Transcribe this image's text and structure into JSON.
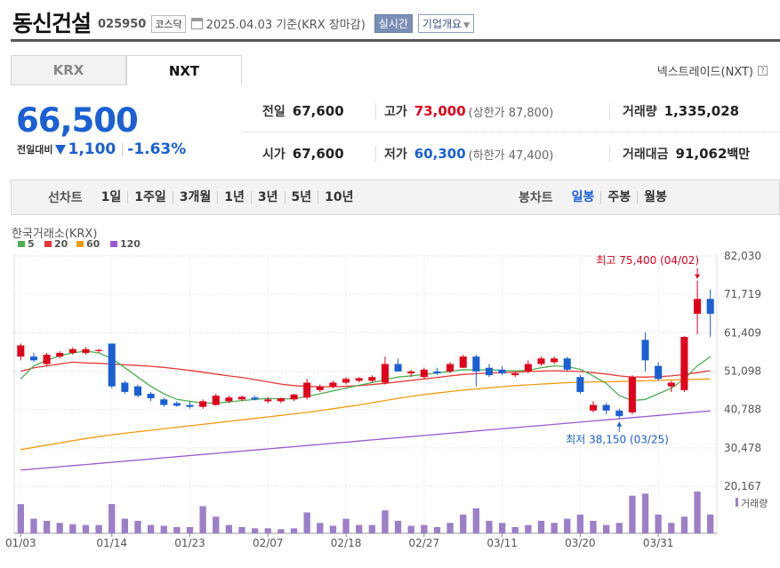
{
  "header": {
    "company_name": "동신건설",
    "code": "025950",
    "market": "코스닥",
    "date_text": "2025.04.03  기준(KRX 장마감)",
    "realtime_button": "실시간",
    "company_info_button": "기업개요",
    "calendar_icon": "calendar-icon"
  },
  "tabs": {
    "krx": "KRX",
    "nxt": "NXT",
    "selected": "NXT"
  },
  "nextrade_label": "넥스트레이드(NXT)",
  "price": {
    "current": "66,500",
    "change_label": "전일대비",
    "change": "1,100",
    "change_pct": "-1.63%",
    "direction": "down"
  },
  "summary": {
    "prev_close_label": "전일",
    "prev_close": "67,600",
    "high_label": "고가",
    "high": "73,000",
    "upper_limit": "(상한가 87,800)",
    "volume_label": "거래량",
    "volume": "1,335,028",
    "open_label": "시가",
    "open": "67,600",
    "low_label": "저가",
    "low": "60,300",
    "lower_limit": "(하한가 47,400)",
    "amount_label": "거래대금",
    "amount": "91,062",
    "amount_unit": "백만"
  },
  "period_bar": {
    "line_title": "선차트",
    "line_items": [
      "1일",
      "1주일",
      "3개월",
      "1년",
      "3년",
      "5년",
      "10년"
    ],
    "candle_title": "봉차트",
    "candle_items": [
      "일봉",
      "주봉",
      "월봉"
    ],
    "candle_selected": "일봉"
  },
  "colors": {
    "up": "#e0001b",
    "down": "#1a5fd4",
    "ma5": "#4caf50",
    "ma20": "#e53935",
    "ma60": "#f39c12",
    "ma120": "#9b59d0",
    "volume": "#9b80c8"
  },
  "chart_data": {
    "type": "candlestick",
    "source_label": "한국거래소(KRX)",
    "legend": [
      {
        "name": "5",
        "color": "#4caf50"
      },
      {
        "name": "20",
        "color": "#e53935"
      },
      {
        "name": "60",
        "color": "#f39c12"
      },
      {
        "name": "120",
        "color": "#9b59d0"
      }
    ],
    "y_ticks": [
      "82,030",
      "71,719",
      "61,409",
      "51,098",
      "40,788",
      "30,478",
      "20,167"
    ],
    "ylim": [
      20167,
      82030
    ],
    "x_ticks": [
      {
        "label": "01/03",
        "index": 0
      },
      {
        "label": "01/14",
        "index": 7
      },
      {
        "label": "01/23",
        "index": 13
      },
      {
        "label": "02/07",
        "index": 19
      },
      {
        "label": "02/18",
        "index": 25
      },
      {
        "label": "02/27",
        "index": 31
      },
      {
        "label": "03/11",
        "index": 37
      },
      {
        "label": "03/20",
        "index": 43
      },
      {
        "label": "03/31",
        "index": 49
      }
    ],
    "n_days": 52,
    "candles": [
      [
        55000,
        58500,
        54000,
        58000
      ],
      [
        55000,
        56000,
        53500,
        54000
      ],
      [
        53000,
        56000,
        52500,
        55500
      ],
      [
        55000,
        56500,
        54500,
        56000
      ],
      [
        56000,
        57500,
        55500,
        57000
      ],
      [
        56000,
        57500,
        55500,
        57000
      ],
      [
        56500,
        57000,
        56000,
        56800
      ],
      [
        58500,
        58500,
        46500,
        47000
      ],
      [
        48000,
        48500,
        45000,
        45500
      ],
      [
        47000,
        47500,
        44000,
        44500
      ],
      [
        45000,
        45500,
        43000,
        43800
      ],
      [
        43500,
        44000,
        41500,
        42000
      ],
      [
        42500,
        43000,
        41500,
        41800
      ],
      [
        42000,
        43000,
        41000,
        41500
      ],
      [
        41500,
        43500,
        41000,
        43000
      ],
      [
        42000,
        45000,
        41800,
        44500
      ],
      [
        43000,
        44500,
        42500,
        44000
      ],
      [
        43500,
        44500,
        43000,
        44200
      ],
      [
        44000,
        44500,
        43200,
        43500
      ],
      [
        43000,
        44000,
        42500,
        43500
      ],
      [
        43000,
        44000,
        42500,
        43800
      ],
      [
        43500,
        45000,
        43000,
        44800
      ],
      [
        44000,
        49000,
        43500,
        48000
      ],
      [
        46000,
        47500,
        45500,
        47000
      ],
      [
        47000,
        48500,
        46500,
        48000
      ],
      [
        48000,
        49500,
        47500,
        49000
      ],
      [
        48500,
        49500,
        48000,
        49200
      ],
      [
        48500,
        50000,
        48000,
        49500
      ],
      [
        48000,
        55000,
        47500,
        53000
      ],
      [
        53000,
        54500,
        51000,
        51000
      ],
      [
        50500,
        51500,
        49500,
        51000
      ],
      [
        49500,
        52000,
        49000,
        51500
      ],
      [
        51000,
        52000,
        50000,
        50500
      ],
      [
        51000,
        53500,
        50500,
        53000
      ],
      [
        52000,
        55500,
        52000,
        55000
      ],
      [
        55000,
        55500,
        47000,
        51000
      ],
      [
        52000,
        53000,
        49500,
        50000
      ],
      [
        51500,
        52500,
        50000,
        50500
      ],
      [
        50000,
        51000,
        49500,
        50500
      ],
      [
        51000,
        54000,
        50500,
        53000
      ],
      [
        53000,
        55000,
        52500,
        54500
      ],
      [
        53500,
        55000,
        53000,
        54500
      ],
      [
        54500,
        55000,
        51000,
        51500
      ],
      [
        49500,
        50000,
        45000,
        45500
      ],
      [
        40500,
        43000,
        40000,
        42000
      ],
      [
        42000,
        42500,
        39500,
        40500
      ],
      [
        40500,
        41000,
        38150,
        39000
      ],
      [
        40000,
        50000,
        39500,
        49500
      ],
      [
        59500,
        61500,
        51000,
        54000
      ],
      [
        52500,
        53500,
        48500,
        49000
      ],
      [
        47000,
        48500,
        45500,
        48000
      ],
      [
        46000,
        60500,
        45500,
        60300
      ]
    ],
    "candles_extra": [
      [
        66500,
        75400,
        61000,
        70500
      ],
      [
        70500,
        73000,
        60300,
        66500
      ]
    ],
    "ma5": [
      49000,
      52500,
      54000,
      55200,
      56000,
      56500,
      56000,
      54500,
      52000,
      49500,
      47000,
      45000,
      43500,
      43000,
      42500,
      42500,
      42800,
      43200,
      43500,
      43800,
      43600,
      43700,
      44300,
      45000,
      45800,
      46500,
      47300,
      48000,
      48800,
      49500,
      49800,
      50200,
      50600,
      51000,
      51500,
      51400,
      51500,
      51300,
      51200,
      51300,
      52000,
      52500,
      52300,
      51600,
      49800,
      47800,
      44500,
      43200,
      43500,
      45000,
      46500,
      49000,
      52500,
      55000
    ],
    "ma20": [
      51000,
      52000,
      52500,
      53000,
      53500,
      53300,
      53200,
      53000,
      52800,
      52600,
      52400,
      52100,
      51700,
      51300,
      50800,
      50300,
      49800,
      49400,
      48800,
      48200,
      47600,
      47200,
      47000,
      46900,
      46900,
      47000,
      47200,
      47500,
      47800,
      48200,
      48600,
      49000,
      49400,
      49800,
      50200,
      50400,
      50600,
      50700,
      50800,
      51000,
      51100,
      51200,
      51100,
      51000,
      50700,
      50300,
      49800,
      49500,
      49500,
      49600,
      49800,
      50200,
      50700,
      51200
    ],
    "ma60": [
      30000,
      30600,
      31200,
      31800,
      32400,
      33000,
      33500,
      34000,
      34400,
      34800,
      35200,
      35600,
      36000,
      36400,
      36800,
      37200,
      37600,
      38000,
      38400,
      38800,
      39200,
      39600,
      40000,
      40500,
      41000,
      41500,
      42000,
      42600,
      43200,
      43800,
      44300,
      44800,
      45200,
      45600,
      46000,
      46300,
      46600,
      46900,
      47200,
      47400,
      47600,
      47800,
      48000,
      48100,
      48200,
      48200,
      48300,
      48400,
      48500,
      48600,
      48700,
      48800,
      48900,
      49000
    ],
    "ma120": [
      24500,
      24800,
      25100,
      25400,
      25700,
      26000,
      26300,
      26600,
      26900,
      27200,
      27500,
      27800,
      28100,
      28400,
      28700,
      29000,
      29300,
      29600,
      29900,
      30200,
      30500,
      30800,
      31100,
      31400,
      31700,
      32000,
      32300,
      32600,
      32900,
      33200,
      33500,
      33800,
      34100,
      34400,
      34700,
      35000,
      35300,
      35600,
      35900,
      36200,
      36500,
      36800,
      37100,
      37400,
      37700,
      38000,
      38300,
      38600,
      38900,
      39200,
      39500,
      39800,
      40100,
      40400
    ],
    "volume_label": "거래량",
    "volumes": [
      0.7,
      0.35,
      0.3,
      0.25,
      0.22,
      0.2,
      0.2,
      0.7,
      0.35,
      0.3,
      0.2,
      0.18,
      0.15,
      0.15,
      0.65,
      0.4,
      0.2,
      0.15,
      0.12,
      0.12,
      0.1,
      0.12,
      0.5,
      0.25,
      0.18,
      0.35,
      0.2,
      0.2,
      0.55,
      0.3,
      0.18,
      0.2,
      0.15,
      0.25,
      0.45,
      0.6,
      0.3,
      0.25,
      0.15,
      0.2,
      0.3,
      0.25,
      0.35,
      0.45,
      0.3,
      0.2,
      0.25,
      0.9,
      0.95,
      0.45,
      0.25,
      0.4,
      1.0,
      0.45
    ],
    "max_label": "최고 75,400 (04/02)",
    "min_label": "최저 38,150 (03/25)"
  }
}
